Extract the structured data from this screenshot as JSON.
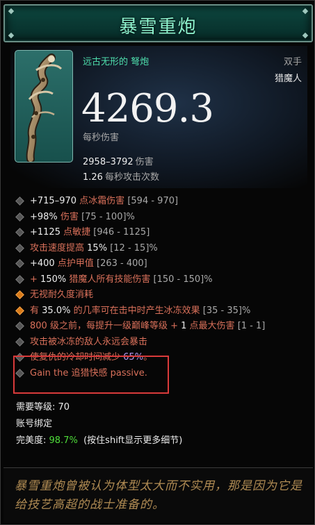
{
  "item": {
    "name": "暴雪重炮",
    "type_name": "远古无形的 弩炮",
    "slot": "双手",
    "class_req": "猎魔人",
    "dps": "4269.3",
    "dps_label": "每秒伤害",
    "damage": "2958–3792",
    "damage_label": "伤害",
    "attacks_per_second": "1.26",
    "aps_label": "每秒攻击次数"
  },
  "affixes": {
    "a1": {
      "value": "+715–970",
      "text": "点冰霜伤害",
      "range": "[594 - 970]"
    },
    "a2": {
      "value": "+98%",
      "text": "伤害",
      "range": "[75 - 100]%"
    },
    "a3": {
      "value": "+1125",
      "text": "点敏捷",
      "range": "[946 - 1125]"
    },
    "a4": {
      "text": "攻击速度提高",
      "value": "15%",
      "range": "[12 - 15]%"
    },
    "a5": {
      "value": "+400",
      "text": "点护甲值",
      "range": "[263 - 400]"
    },
    "a6": {
      "plus": "+",
      "value": "150%",
      "text": "猎魔人所有技能伤害",
      "range": "[150 - 150]%"
    },
    "a7": {
      "text": "无视耐久度消耗"
    },
    "a8": {
      "pre": "有",
      "value": "35.0%",
      "text": "的几率可在击中时产生冰冻效果",
      "range": "[35 - 35]%"
    },
    "a9": {
      "text1": "800 级之前，每提升一级巅峰等级 +",
      "value": "1",
      "text2": "点最大伤害",
      "range": "[1 - 1]"
    },
    "a10": {
      "text": "攻击被冰冻的敌人永远会暴击"
    },
    "a11": {
      "text": "使复仇的冷却时间减少",
      "value": "65%",
      "suffix": "。"
    },
    "a12": {
      "pre": "Gain the",
      "name": "追猎快感",
      "post": "passive."
    }
  },
  "footer": {
    "level_label": "需要等级:",
    "level_value": "70",
    "account_bound": "账号绑定",
    "perfection_label": "完美度:",
    "perfection_value": "98.7%",
    "shift_hint": "(按住shift显示更多细节)"
  },
  "flavor_text": "暴雪重炮曾被认为体型太大而不实用，那是因为它是给技艺高超的战士准备的。",
  "colors": {
    "title": "#8ff4cf",
    "type_name": "#4fe0ae",
    "affix_red": "#d9705a",
    "legendary_purple": "#b59cf7",
    "perfection_green": "#4fdc3a",
    "highlight_box": "#d93a3a",
    "flavor": "#b08b53"
  },
  "icons": {
    "item": "crossbow-icon",
    "bullet": "diamond-bullet-icon",
    "bullet_orange": "orange-diamond-bullet-icon"
  }
}
